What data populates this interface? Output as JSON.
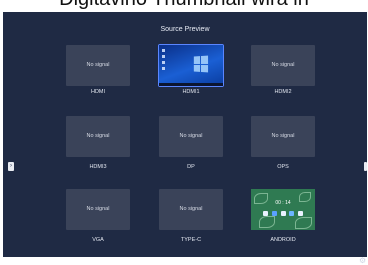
{
  "banner": {
    "text": "Digitavino Thumbnail wira in"
  },
  "title": "Source Preview",
  "sources": [
    {
      "label": "HDMI",
      "status": "No signal"
    },
    {
      "label": "HDMI1",
      "status": "",
      "preview": "windows-desktop"
    },
    {
      "label": "HDMI2",
      "status": "No signal"
    },
    {
      "label": "HDMI3",
      "status": "No signal"
    },
    {
      "label": "DP",
      "status": "No signal"
    },
    {
      "label": "OPS",
      "status": "No signal"
    },
    {
      "label": "VGA",
      "status": "No signal"
    },
    {
      "label": "TYPE-C",
      "status": "No signal"
    },
    {
      "label": "ANDROID",
      "status": "",
      "preview": "android-home",
      "clock": "00 : 14"
    }
  ],
  "controls": {
    "prev_icon": "chevron-left-icon",
    "next_icon": "chevron-right-icon",
    "settings_icon": "gear-icon"
  },
  "colors": {
    "background": "#1f2a44",
    "tile": "#3a4359",
    "text": "#e3e7f0",
    "selected": "#5a86ff"
  }
}
